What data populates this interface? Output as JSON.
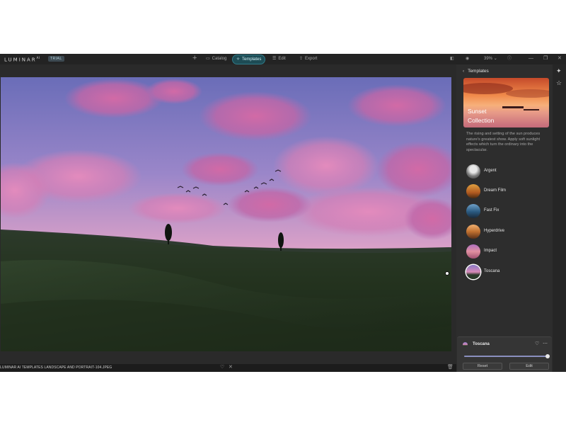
{
  "app": {
    "logo": "LUMINAR",
    "logo_sup": "AI",
    "trial_badge": "TRIAL",
    "add_icon": "plus-icon"
  },
  "nav": {
    "catalog_label": "Catalog",
    "templates_label": "Templates",
    "edit_label": "Edit",
    "export_label": "Export"
  },
  "toolbar": {
    "zoom": "39%",
    "icons": [
      "compare-icon",
      "eye-icon",
      "chevron-down-icon",
      "help-icon"
    ]
  },
  "window_controls": {
    "minimize": "—",
    "maximize": "❐",
    "close": "✕"
  },
  "bottom_bar": {
    "filename": "LUMINAR AI TEMPLATES LANDSCAPE AND PORTRAIT-104.JPEG",
    "icons": [
      "heart-icon",
      "reject-icon",
      "trash-icon"
    ]
  },
  "panel": {
    "title": "Templates",
    "banner_title": "Sunset",
    "banner_subtitle": "Collection",
    "description": "The rising and setting of the sun produces nature's greatest show. Apply soft sunlight effects which turn the ordinary into the spectacular.",
    "templates": [
      {
        "name": "Argent",
        "selected": false
      },
      {
        "name": "Dream Film",
        "selected": false
      },
      {
        "name": "Fast Fix",
        "selected": false
      },
      {
        "name": "Hyperdrive",
        "selected": false
      },
      {
        "name": "Impact",
        "selected": false
      },
      {
        "name": "Toscana",
        "selected": true
      }
    ]
  },
  "rail": {
    "icons": [
      "templates-magic-icon",
      "star-icon"
    ]
  },
  "card": {
    "name": "Toscana",
    "amount": 1.0,
    "reset_label": "Reset",
    "edit_label": "Edit"
  },
  "colors": {
    "accent": "#2f7a88",
    "panel_bg": "#2d2d2d",
    "app_bg": "#2a2a2a"
  }
}
